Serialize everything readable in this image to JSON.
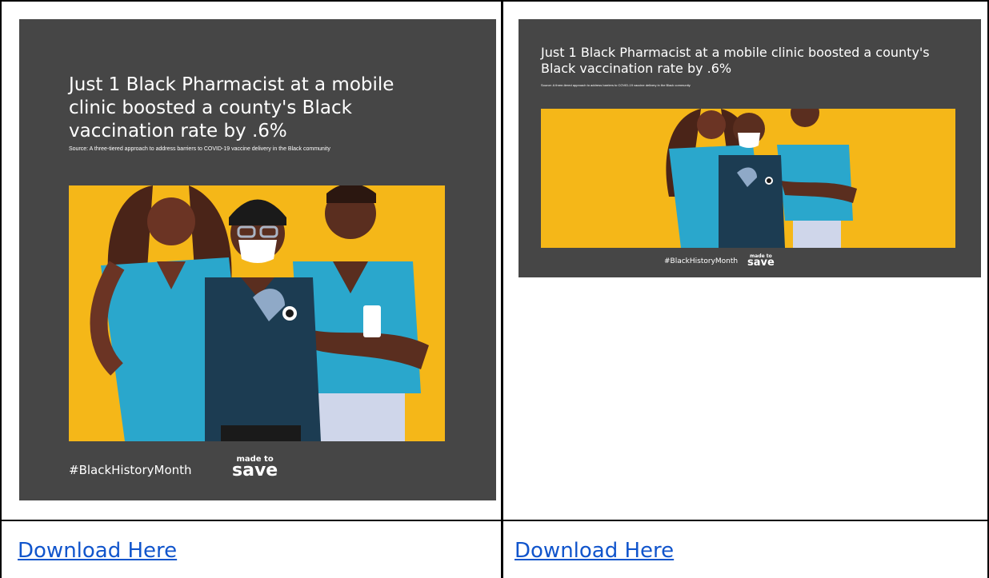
{
  "cells": [
    {
      "graphic": {
        "title": "Just 1 Black Pharmacist at a mobile clinic boosted a county's Black vaccination rate by .6%",
        "source": "Source: A three-tiered approach to address barriers to COVID-19 vaccine delivery in the Black community",
        "hashtag": "#BlackHistoryMonth",
        "logo_top": "made to",
        "logo_bottom": "save"
      },
      "link_label": "Download Here"
    },
    {
      "graphic": {
        "title": "Just 1 Black Pharmacist at a mobile clinic boosted a county's Black vaccination rate by .6%",
        "source": "Source: A three-tiered approach to address barriers to COVID-19 vaccine delivery in the Black community",
        "hashtag": "#BlackHistoryMonth",
        "logo_top": "made to",
        "logo_bottom": "save"
      },
      "link_label": "Download Here"
    }
  ],
  "colors": {
    "card_bg": "#464646",
    "panel_yellow": "#f5b718",
    "scrub_teal": "#2aa7cc",
    "scrub_navy": "#1c3c52",
    "skin_dark": "#5a2e1f",
    "link_blue": "#1155cc"
  }
}
